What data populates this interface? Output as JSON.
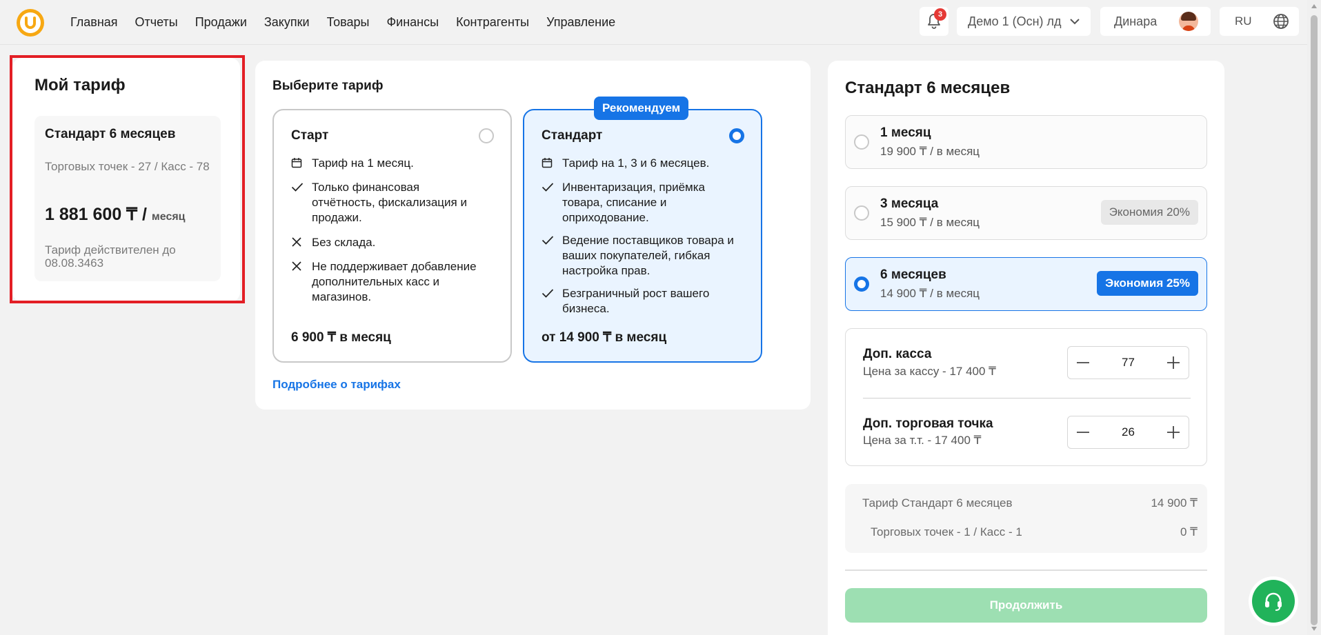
{
  "nav": {
    "items": [
      {
        "label": "Главная"
      },
      {
        "label": "Отчеты"
      },
      {
        "label": "Продажи"
      },
      {
        "label": "Закупки"
      },
      {
        "label": "Товары"
      },
      {
        "label": "Финансы"
      },
      {
        "label": "Контрагенты"
      },
      {
        "label": "Управление"
      }
    ]
  },
  "header": {
    "notifications_count": "3",
    "company": "Демо 1 (Осн) лд",
    "user_name": "Динара",
    "language": "RU"
  },
  "my_plan": {
    "title": "Мой тариф",
    "plan_name": "Стандарт 6 месяцев",
    "points": "Торговых точек - 27 / Касс - 78",
    "price": "1 881 600 ₸ /",
    "unit": "месяц",
    "valid_until": "Тариф действителен до 08.08.3463"
  },
  "choose": {
    "title": "Выберите тариф",
    "recommend_badge": "Рекомендуем",
    "start": {
      "name": "Старт",
      "features": [
        {
          "icon": "calendar-icon",
          "text": "Тариф на 1 месяц."
        },
        {
          "icon": "check-icon",
          "text": "Только финансовая отчётность, фискализация и продажи."
        },
        {
          "icon": "cross-icon",
          "text": "Без склада."
        },
        {
          "icon": "cross-icon",
          "text": "Не поддерживает добавление дополнительных касс и магазинов."
        }
      ],
      "price": "6 900 ₸ в месяц"
    },
    "standard": {
      "name": "Стандарт",
      "features": [
        {
          "icon": "calendar-icon",
          "text": "Тариф на 1, 3 и 6 месяцев."
        },
        {
          "icon": "check-icon",
          "text": "Инвентаризация, приёмка товара, списание и оприходование."
        },
        {
          "icon": "check-icon",
          "text": "Ведение поставщиков товара и ваших покупателей, гибкая настройка прав."
        },
        {
          "icon": "check-icon",
          "text": "Безграничный рост вашего бизнеса."
        }
      ],
      "price": "от 14 900 ₸ в месяц"
    },
    "more_link": "Подробнее о тарифах"
  },
  "summary": {
    "title": "Стандарт 6 месяцев",
    "periods": [
      {
        "title": "1 месяц",
        "price": "19 900 ₸ / в месяц",
        "savings": ""
      },
      {
        "title": "3 месяца",
        "price": "15 900 ₸ / в месяц",
        "savings": "Экономия 20%"
      },
      {
        "title": "6 месяцев",
        "price": "14 900 ₸ / в месяц",
        "savings": "Экономия 25%"
      }
    ],
    "addons": [
      {
        "title": "Доп. касса",
        "sub": "Цена за кассу - 17 400 ₸",
        "value": "77"
      },
      {
        "title": "Доп. торговая точка",
        "sub": "Цена за т.т. - 17 400 ₸",
        "value": "26"
      }
    ],
    "totals": [
      {
        "label": "Тариф Стандарт 6 месяцев",
        "value": "14 900 ₸"
      },
      {
        "label": "Торговых точек - 1 / Касс - 1",
        "value": "0 ₸"
      }
    ],
    "continue": "Продолжить"
  },
  "colors": {
    "accent": "#1674e6",
    "brand": "#f7a813",
    "highlight": "#e31e25",
    "continue_disabled": "#9ddfb2",
    "support": "#21b35a"
  }
}
